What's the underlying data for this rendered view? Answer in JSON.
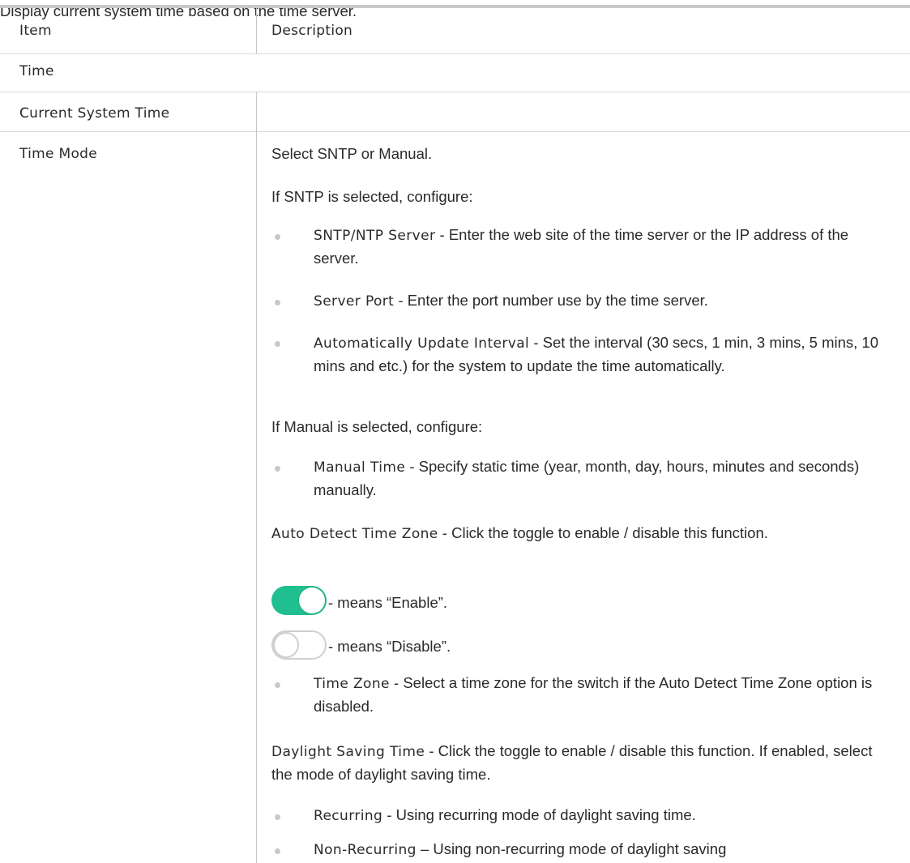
{
  "table": {
    "header": {
      "item": "Item",
      "description": "Description"
    },
    "section_title": "Time",
    "rows": [
      {
        "item": "Current System Time",
        "description": "Display current system time based on the time server."
      },
      {
        "item": "Time Mode"
      }
    ]
  },
  "time_mode": {
    "intro": "Select SNTP or Manual.",
    "sntp_intro": "If SNTP is selected, configure:",
    "sntp_items": [
      {
        "term": "SNTP/NTP Server",
        "text": " - Enter the web site of the time server or the IP address of the server."
      },
      {
        "term": "Server Port",
        "text": " - Enter the port number use by the time server."
      },
      {
        "term": "Automatically Update Interval",
        "text": " - Set the interval (30 secs, 1 min, 3 mins, 5 mins, 10 mins and etc.) for the system to update the time automatically."
      }
    ],
    "manual_intro": "If Manual is selected, configure:",
    "manual_items": [
      {
        "term": "Manual Time",
        "text": " - Specify static time (year, month, day, hours, minutes and seconds) manually."
      }
    ],
    "auto_detect": {
      "term": "Auto Detect Time Zone",
      "text": " - Click the toggle to enable / disable this function."
    },
    "toggle_enable_note": "- means “Enable”.",
    "toggle_disable_note": "- means “Disable”.",
    "timezone_item": {
      "term": "Time Zone",
      "text": " - Select a time zone for the switch if the Auto Detect Time Zone option is disabled."
    },
    "daylight": {
      "term": "Daylight Saving Time",
      "text": " - Click the toggle to enable / disable this function. If enabled, select the mode of daylight saving time."
    },
    "daylight_items": [
      {
        "term": "Recurring",
        "text": " - Using recurring mode of daylight saving time."
      },
      {
        "term": "Non-Recurring",
        "text": " – Using non-recurring mode of daylight saving"
      }
    ]
  },
  "colors": {
    "toggle_on": "#1fbf8f",
    "toggle_off_border": "#cfcfcf",
    "rule": "#c9c9c9"
  }
}
